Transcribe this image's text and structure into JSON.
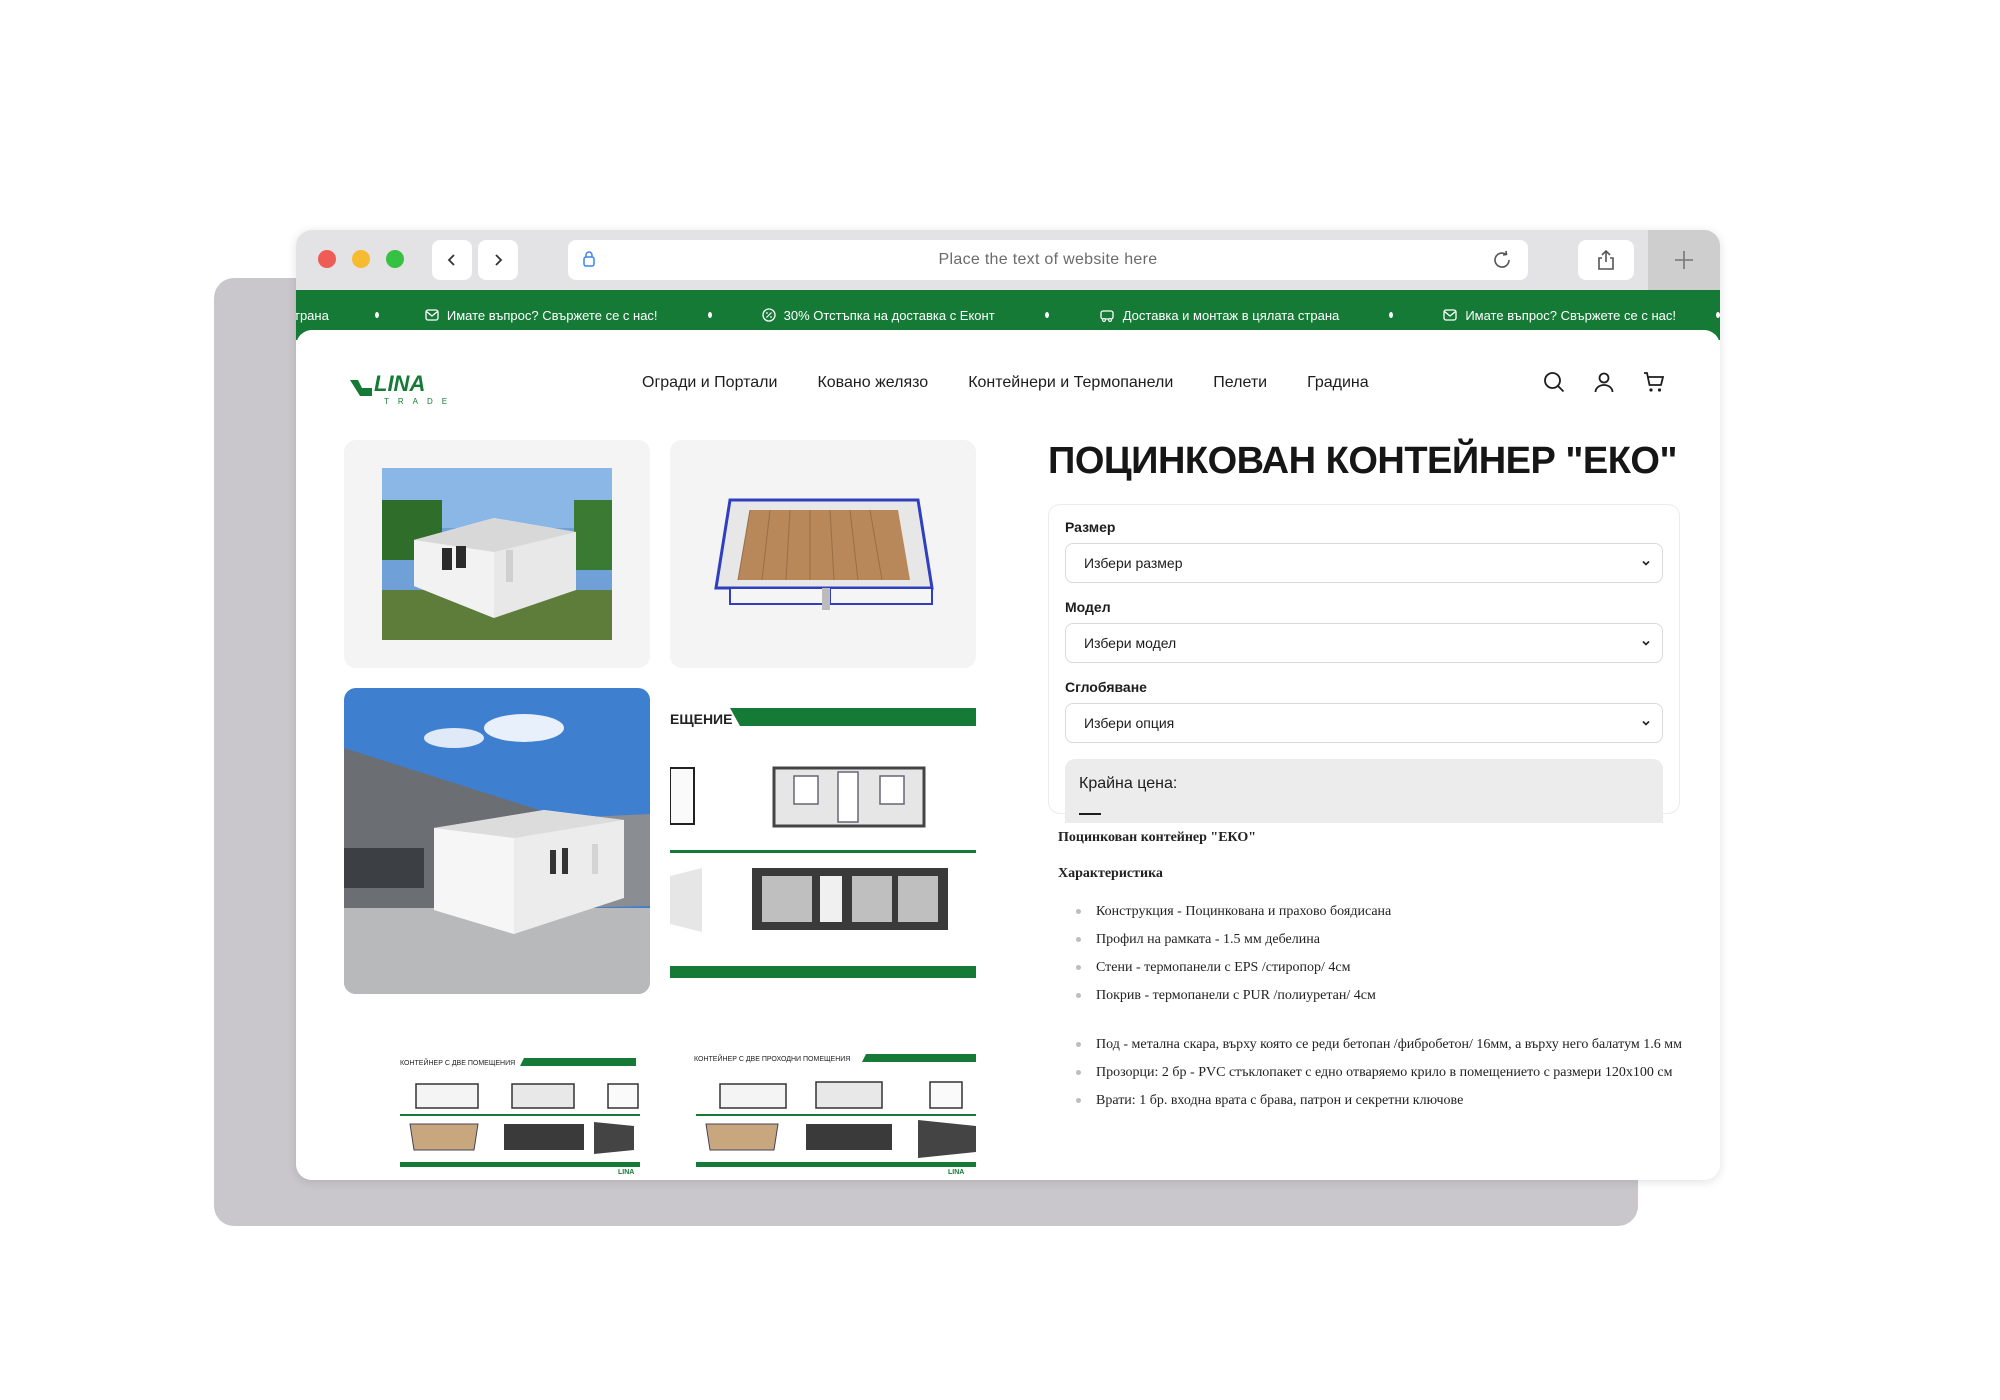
{
  "browser": {
    "address_placeholder": "Place the text of website here"
  },
  "ticker": {
    "items": [
      {
        "text": "трана",
        "icon": ""
      },
      {
        "text": "Имате въпрос? Свържете се с нас!",
        "icon": "mail-icon"
      },
      {
        "text": "30% Отстъпка на доставка с Еконт",
        "icon": "discount-icon"
      },
      {
        "text": "Доставка и монтаж в цялата страна",
        "icon": "delivery-icon"
      },
      {
        "text": "Имате въпрос? Свържете се с нас!",
        "icon": "mail-icon"
      }
    ],
    "color": "#157a35"
  },
  "brand": {
    "name": "LINA",
    "tagline": "TRADE",
    "color": "#157a35"
  },
  "nav": {
    "items": [
      "Огради и Портали",
      "Ковано желязо",
      "Контейнери и Термопанели",
      "Пелети",
      "Градина"
    ]
  },
  "gallery": {
    "plan_heading": "ЕЩЕНИЕ",
    "thumb_caption_1": "КОНТЕЙНЕР С ДВЕ ПОМЕЩЕНИЯ",
    "thumb_caption_2": "КОНТЕЙНЕР С ДВЕ ПРОХОДНИ ПОМЕЩЕНИЯ",
    "thumb_logo": "LINA"
  },
  "product": {
    "title": "ПОЦИНКОВАН КОНТЕЙНЕР \"ЕКО\"",
    "options": [
      {
        "label": "Размер",
        "value": "Избери размер"
      },
      {
        "label": "Модел",
        "value": "Избери модел"
      },
      {
        "label": "Сглобяване",
        "value": "Избери опция"
      }
    ],
    "price_label": "Крайна цена:"
  },
  "description": {
    "heading": "Поцинкован контейнер \"ЕКО\"",
    "subheading": "Характеристика",
    "list1": [
      "Конструкция - Поцинкована и прахово боядисана",
      "Профил на рамката - 1.5 мм дебелина",
      "Стени - термопанели с EPS /стиропор/ 4см",
      "Покрив - термопанели с PUR /полиуретан/ 4см"
    ],
    "list2": [
      "Под -  метална скара, върху която се реди бетопан /фибробетон/ 16мм, а върху него балатум  1.6 мм",
      "Прозорци: 2 бр - PVC стъклопакет с едно отваряемо крило в помещението с размери 120х100 см",
      "Врати: 1 бр. входна врата с брава, патрон и секретни ключове"
    ]
  }
}
